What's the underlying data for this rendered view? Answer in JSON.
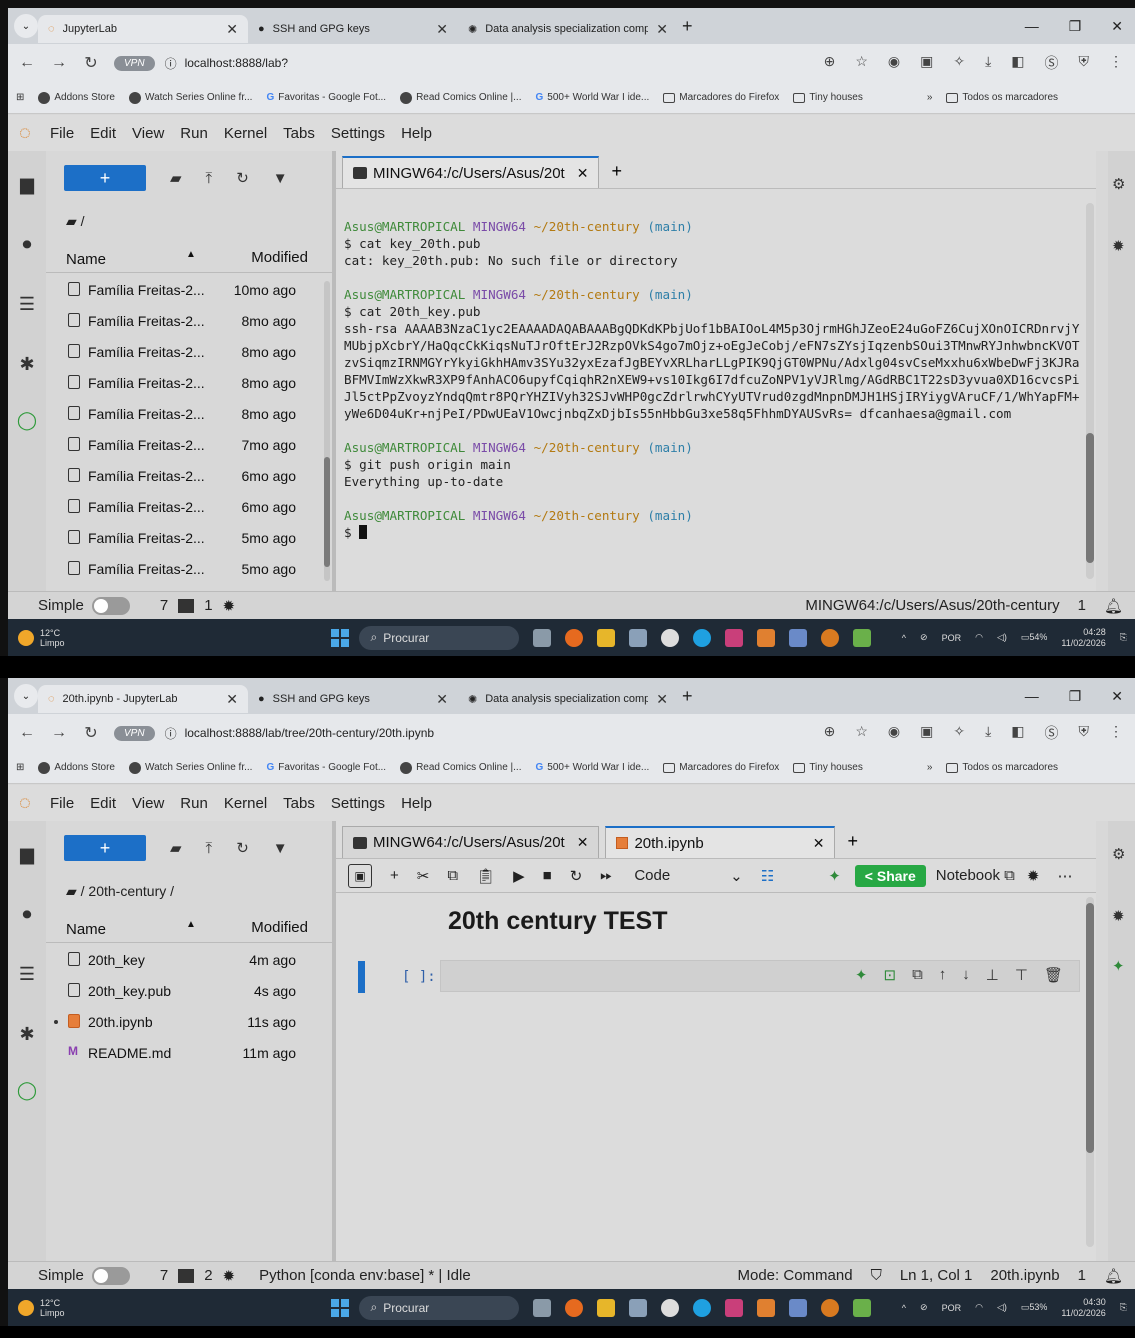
{
  "shot1": {
    "browser": {
      "tabs": [
        {
          "label": "JupyterLab"
        },
        {
          "label": "SSH and GPG keys"
        },
        {
          "label": "Data analysis specialization compa"
        }
      ],
      "url": "localhost:8888/lab?",
      "vpn_label": "VPN"
    },
    "jupyter": {
      "breadcrumb": "/",
      "files": [
        {
          "name": "Família Freitas-2...",
          "modified": "10mo ago"
        },
        {
          "name": "Família Freitas-2...",
          "modified": "8mo ago"
        },
        {
          "name": "Família Freitas-2...",
          "modified": "8mo ago"
        },
        {
          "name": "Família Freitas-2...",
          "modified": "8mo ago"
        },
        {
          "name": "Família Freitas-2...",
          "modified": "8mo ago"
        },
        {
          "name": "Família Freitas-2...",
          "modified": "7mo ago"
        },
        {
          "name": "Família Freitas-2...",
          "modified": "6mo ago"
        },
        {
          "name": "Família Freitas-2...",
          "modified": "6mo ago"
        },
        {
          "name": "Família Freitas-2...",
          "modified": "5mo ago"
        },
        {
          "name": "Família Freitas-2...",
          "modified": "5mo ago"
        }
      ],
      "doc_tab": "MINGW64:/c/Users/Asus/20t",
      "terminal": {
        "prompt_user": "Asus@MARTROPICAL",
        "prompt_host": "MINGW64",
        "prompt_path": "~/20th-century",
        "prompt_branch": "(main)",
        "cmd1": "$ cat key_20th.pub",
        "out1": "cat: key_20th.pub: No such file or directory",
        "cmd2": "$ cat 20th_key.pub",
        "out2": "ssh-rsa AAAAB3NzaC1yc2EAAAADAQABAAABgQDKdKPbjUof1bBAIOoL4M5p3OjrmHGhJZeoE24uGoFZ6CujXOnOICRDnrvjYMUbjpXcbrY/HaQqcCkKiqsNuTJrOftErJ2RzpOVkS4go7mOjz+oEgJeCobj/eFN7sZYsjIqzenbSOui3TMnwRYJnhwbncKVOTzvSiqmzIRNMGYrYkyiGkhHAmv3SYu32yxEzafJgBEYvXRLharLLgPIK9QjGT0WPNu/Adxlg04svCseMxxhu6xWbeDwFj3KJRaBFMVImWzXkwR3XP9fAnhACO6upyfCqiqhR2nXEW9+vs10Ikg6I7dfcuZoNPV1yVJRlmg/AGdRBC1T22sD3yvua0XD16cvcsPiJl5ctPpZvoyzYndqQmtr8PQrYHZIVyh32SJvWHP0gcZdrlrwhCYyUTVrud0zgdMnpnDMJH1HSjIRYiygVAruCF/1/WhYapFM+yWe6D04uKr+njPeI/PDwUEaV1OwcjnbqZxDjbIs55nHbbGu3xe58q5FhhmDYAUSvRs= dfcanhaesa@gmail.com",
        "cmd3": "$ git push origin main",
        "out3": "Everything up-to-date",
        "cmd4": "$ "
      },
      "status": {
        "mode": "Simple",
        "terminals": "7",
        "kernels": "1",
        "right_text": "MINGW64:/c/Users/Asus/20th-century",
        "notifications": "1"
      }
    },
    "taskbar": {
      "temp": "12°C",
      "weather": "Limpo",
      "search": "Procurar",
      "lang": "POR",
      "battery": "54%",
      "time": "04:28",
      "date": "11/02/2026"
    }
  },
  "shot2": {
    "browser": {
      "tabs": [
        {
          "label": "20th.ipynb - JupyterLab"
        },
        {
          "label": "SSH and GPG keys"
        },
        {
          "label": "Data analysis specialization compa"
        }
      ],
      "url": "localhost:8888/lab/tree/20th-century/20th.ipynb",
      "vpn_label": "VPN"
    },
    "jupyter": {
      "breadcrumb": "/ 20th-century /",
      "files": [
        {
          "name": "20th_key",
          "modified": "4m ago"
        },
        {
          "name": "20th_key.pub",
          "modified": "4s ago"
        },
        {
          "name": "20th.ipynb",
          "modified": "11s ago"
        },
        {
          "name": "README.md",
          "modified": "11m ago"
        }
      ],
      "doc_tab1": "MINGW64:/c/Users/Asus/20t",
      "doc_tab2": "20th.ipynb",
      "toolbar": {
        "cell_type": "Code",
        "share": "Share",
        "notebook": "Notebook"
      },
      "heading": "20th century TEST",
      "cell_prompt": "[ ]:",
      "status": {
        "mode": "Simple",
        "terminals": "7",
        "kernels": "2",
        "kernel_text": "Python [conda env:base] * | Idle",
        "edit_mode": "Mode: Command",
        "position": "Ln 1, Col 1",
        "filename": "20th.ipynb",
        "notifications": "1"
      }
    },
    "taskbar": {
      "temp": "12°C",
      "weather": "Limpo",
      "search": "Procurar",
      "lang": "POR",
      "battery": "53%",
      "time": "04:30",
      "date": "11/02/2026"
    }
  },
  "shared": {
    "menu": [
      "File",
      "Edit",
      "View",
      "Run",
      "Kernel",
      "Tabs",
      "Settings",
      "Help"
    ],
    "col_name": "Name",
    "col_modified": "Modified",
    "bookmarks": [
      "Addons Store",
      "Watch Series Online fr...",
      "Favoritas - Google Fot...",
      "Read Comics Online |...",
      "500+ World War I ide...",
      "Marcadores do Firefox",
      "Tiny houses",
      "Todos os marcadores"
    ]
  }
}
